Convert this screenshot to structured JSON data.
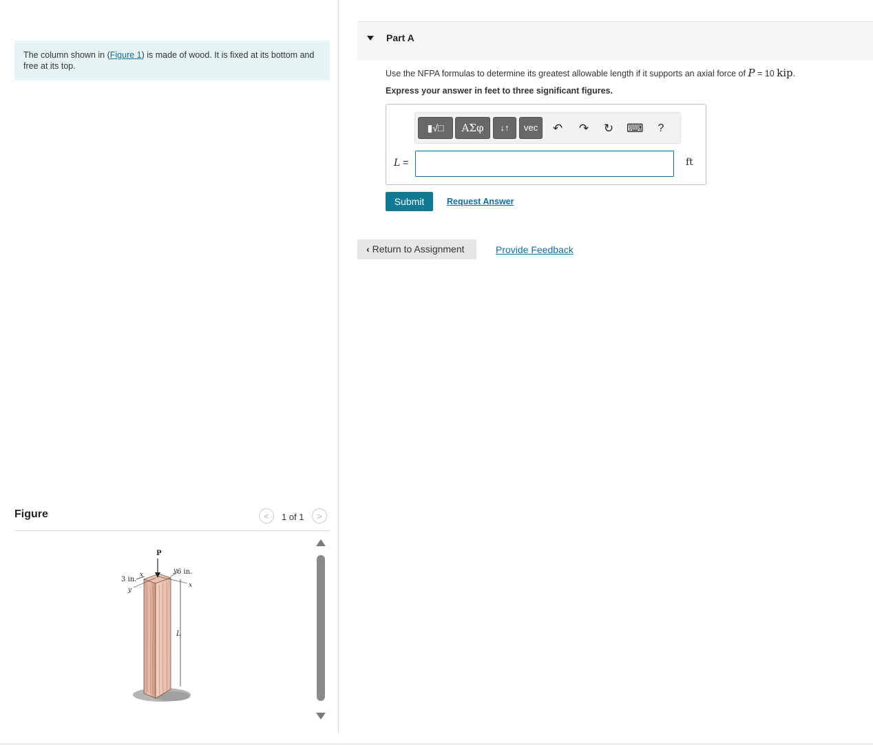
{
  "problem": {
    "text_before": "The column shown in (",
    "figure_link": "Figure 1",
    "text_after": ") is made of wood. It is fixed at its bottom and free at its top."
  },
  "figure": {
    "title": "Figure",
    "counter": "1 of 1",
    "prev_icon": "chevron-left-icon",
    "next_icon": "chevron-right-icon",
    "labels": {
      "load": "P",
      "dim_depth": "3 in.",
      "dim_width": "6 in.",
      "axis_x_left": "x",
      "axis_y_left": "y",
      "axis_y_right": "y",
      "axis_x_right": "x",
      "length": "L"
    }
  },
  "part": {
    "title": "Part A",
    "caret_icon": "caret-down-icon"
  },
  "question": {
    "text": "Use the NFPA formulas to determine its greatest allowable length if it supports an axial force of ",
    "var": "P",
    "equals": " = 10 ",
    "unit": "kip",
    "end": ".",
    "instruction": "Express your answer in feet to three significant figures."
  },
  "toolbar": {
    "template_label": "▮√□",
    "greek_label": "ΑΣφ",
    "arrows_label": "↓↑",
    "vec_label": "vec",
    "undo_icon": "↶",
    "redo_icon": "↷",
    "reset_icon": "↻",
    "keyboard_icon": "⌨",
    "help_label": "?"
  },
  "answer": {
    "variable": "L",
    "equals": " =",
    "value": "",
    "unit": "ft"
  },
  "buttons": {
    "submit": "Submit",
    "request_answer": "Request Answer",
    "return": "Return to Assignment",
    "feedback": "Provide Feedback"
  },
  "colors": {
    "accent": "#0f7a94",
    "link": "#0f6fa3",
    "problem_bg": "#e6f4f5"
  }
}
